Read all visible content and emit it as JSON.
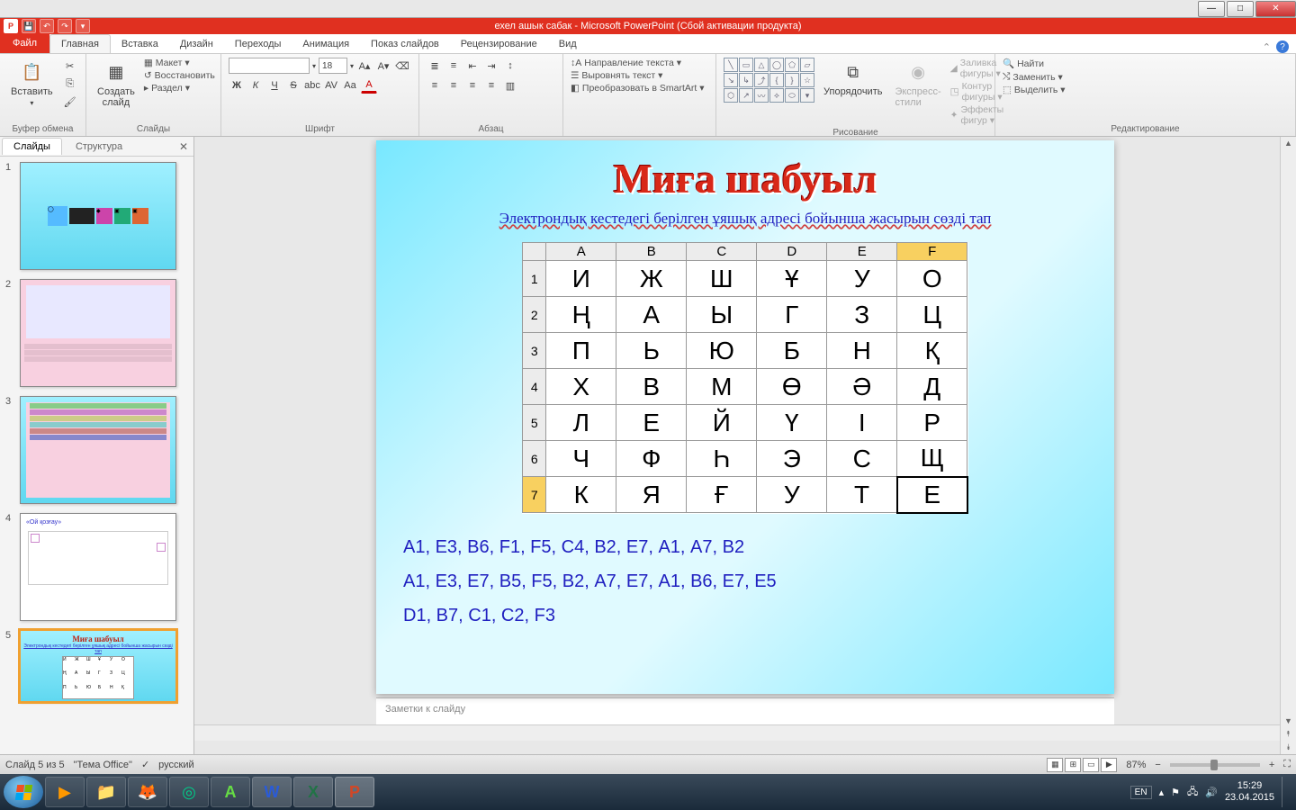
{
  "window": {
    "app_title": "ехел ашык сабак  -  Microsoft PowerPoint (Сбой активации продукта)"
  },
  "qat": {
    "save": "💾",
    "undo": "↶",
    "redo": "↷",
    "more": "▾"
  },
  "tabs": {
    "file": "Файл",
    "list": [
      "Главная",
      "Вставка",
      "Дизайн",
      "Переходы",
      "Анимация",
      "Показ слайдов",
      "Рецензирование",
      "Вид"
    ],
    "active": "Главная"
  },
  "ribbon": {
    "clipboard": {
      "label": "Буфер обмена",
      "paste": "Вставить",
      "cut": "✂",
      "copy": "⎘",
      "fmt": "🖌"
    },
    "slides": {
      "label": "Слайды",
      "new": "Создать\nслайд",
      "layout": "Макет ▾",
      "reset": "Восстановить",
      "section": "Раздел ▾"
    },
    "font": {
      "label": "Шрифт",
      "family": "",
      "size": "18",
      "grow": "A▴",
      "shrink": "A▾",
      "clear": "⌫",
      "bold": "Ж",
      "italic": "К",
      "under": "Ч",
      "strike": "S",
      "shadow": "abc",
      "spacing": "AV",
      "case": "Aa",
      "color": "A"
    },
    "para": {
      "label": "Абзац"
    },
    "textdir": {
      "dir": "Направление текста ▾",
      "align": "Выровнять текст ▾",
      "smart": "Преобразовать в SmartArt ▾"
    },
    "draw": {
      "label": "Рисование",
      "arrange": "Упорядочить",
      "styles": "Экспресс-стили",
      "fill": "Заливка фигуры ▾",
      "outline": "Контур фигуры ▾",
      "effects": "Эффекты фигур ▾"
    },
    "edit": {
      "label": "Редактирование",
      "find": "Найти",
      "replace": "Заменить ▾",
      "select": "Выделить ▾"
    }
  },
  "panel": {
    "tab_slides": "Слайды",
    "tab_outline": "Структура"
  },
  "thumbs": [
    {
      "n": "1"
    },
    {
      "n": "2"
    },
    {
      "n": "3"
    },
    {
      "n": "4"
    },
    {
      "n": "5"
    }
  ],
  "slide": {
    "title": "Миға шабуыл",
    "subtitle": "Электрондық кестедегі берілген ұяшық адресі бойынша жасырын сөзді тап",
    "cols": [
      "A",
      "B",
      "C",
      "D",
      "E",
      "F"
    ],
    "rows": [
      "1",
      "2",
      "3",
      "4",
      "5",
      "6",
      "7"
    ],
    "grid": [
      [
        "И",
        "Ж",
        "Ш",
        "Ұ",
        "У",
        "О"
      ],
      [
        "Ң",
        "А",
        "Ы",
        "Г",
        "З",
        "Ц"
      ],
      [
        "П",
        "Ь",
        "Ю",
        "Б",
        "Н",
        "Қ"
      ],
      [
        "Х",
        "В",
        "М",
        "Ө",
        "Ә",
        "Д"
      ],
      [
        "Л",
        "Е",
        "Й",
        "Ү",
        "І",
        "Р"
      ],
      [
        "Ч",
        "Ф",
        "Һ",
        "Э",
        "С",
        "Щ"
      ],
      [
        "К",
        "Я",
        "Ғ",
        "У",
        "Т",
        "Е"
      ]
    ],
    "seq1": "А1, Е3, В6, F1, F5, С4, В2, Е7, А1, А7, В2",
    "seq2": "А1, Е3, Е7, В5, F5, В2, А7, Е7, А1, В6, Е7, Е5",
    "seq3": " D1, В7, С1, С2, F3"
  },
  "notes": {
    "placeholder": "Заметки к слайду"
  },
  "status": {
    "slide_pos": "Слайд 5 из 5",
    "theme": "\"Тема Office\"",
    "lang": "русский",
    "zoom": "87%"
  },
  "tray": {
    "lang": "EN",
    "time": "15:29",
    "date": "23.04.2015"
  }
}
